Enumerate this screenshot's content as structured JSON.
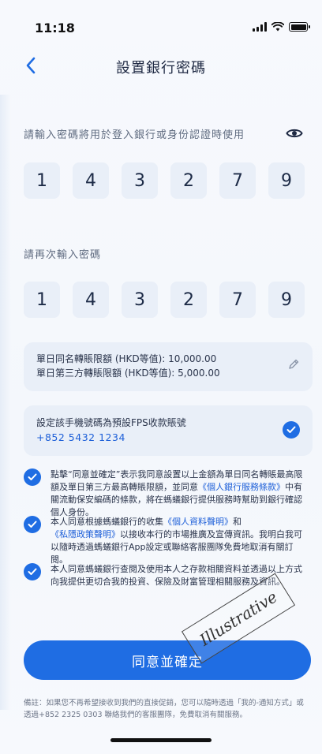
{
  "status_bar": {
    "time": "11:18"
  },
  "nav": {
    "title": "設置銀行密碼"
  },
  "password": {
    "prompt": "請輸入密碼將用於登入銀行或身份認證時使用",
    "digits": [
      "1",
      "4",
      "3",
      "2",
      "7",
      "9"
    ]
  },
  "confirm_password": {
    "prompt": "請再次輸入密碼",
    "digits": [
      "1",
      "4",
      "3",
      "2",
      "7",
      "9"
    ]
  },
  "limits": {
    "same_name": "單日同名轉賬限額 (HKD等值): 10,000.00",
    "third_party": "單日第三方轉賬限額 (HKD等值): 5,000.00"
  },
  "fps": {
    "title": "設定該手機號碼為預設FPS收款賬號",
    "phone": "+852 5432 1234",
    "checked": true
  },
  "consents": [
    {
      "text_a": "點擊“同意並確定”表示我同意設置以上金額為單日同名轉賬最高限額及單日第三方最高轉賬限額，並同意",
      "link": "《個人銀行服務條款》",
      "text_b": "中有關流動保安編碼的條款，將在螞蟻銀行提供服務時幫助到銀行確認個人身份。"
    },
    {
      "text_a": "本人同意根據螞蟻銀行的收集",
      "link": "《個人資料聲明》",
      "text_b": "和",
      "link2": "《私隱政策聲明》",
      "text_c": "以接收本行的市場推廣及宣傳資訊。我明白我可以隨時透過螞蟻銀行App設定或聯絡客服團隊免費地取消有關訂閱。"
    },
    {
      "text_a": "本人同意螞蟻銀行查閱及使用本人之存款相關資料並透過以上方式向我提供更切合我的投資、保險及財富管理相關服務及資訊。"
    }
  ],
  "confirm_button": "同意並確定",
  "footer_note": "備註：如果您不再希望接收到我們的直接促銷，您可以隨時透過「我的-通知方式」或透過+852 2325 0303 聯絡我們的客服團隊，免費取消有關服務。",
  "watermark": "Illustrative",
  "colors": {
    "accent": "#1f6de3",
    "link": "#1d5fd8",
    "box_bg": "#e9eff8",
    "text": "#1f2a44"
  },
  "icons": [
    "chevron-left-icon",
    "eye-icon",
    "pencil-icon",
    "check-icon"
  ]
}
